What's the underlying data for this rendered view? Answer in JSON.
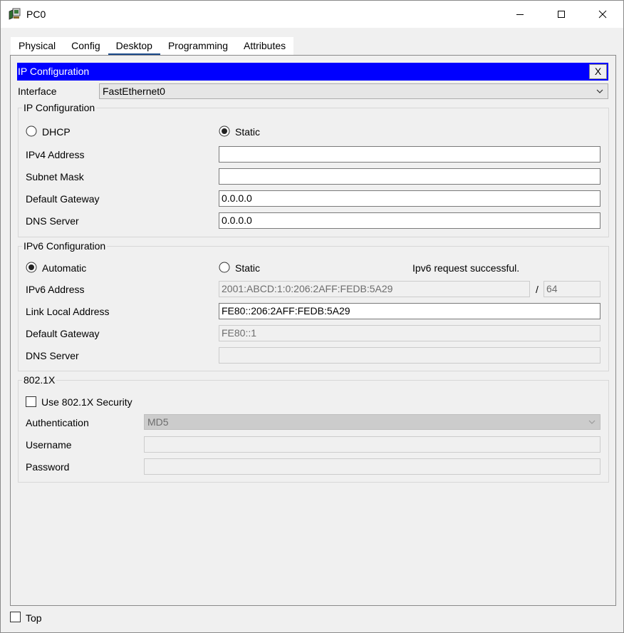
{
  "window": {
    "title": "PC0"
  },
  "tabs": [
    "Physical",
    "Config",
    "Desktop",
    "Programming",
    "Attributes"
  ],
  "active_tab": "Desktop",
  "ip_config_window": {
    "title": "IP Configuration",
    "close_label": "X"
  },
  "interface": {
    "label": "Interface",
    "value": "FastEthernet0"
  },
  "ipv4": {
    "group_title": "IP Configuration",
    "dhcp_label": "DHCP",
    "static_label": "Static",
    "mode": "Static",
    "ipv4_address_label": "IPv4 Address",
    "ipv4_address": "",
    "subnet_mask_label": "Subnet Mask",
    "subnet_mask": "",
    "default_gateway_label": "Default Gateway",
    "default_gateway": "0.0.0.0",
    "dns_server_label": "DNS Server",
    "dns_server": "0.0.0.0"
  },
  "ipv6": {
    "group_title": "IPv6 Configuration",
    "automatic_label": "Automatic",
    "static_label": "Static",
    "mode": "Automatic",
    "status": "Ipv6 request successful.",
    "ipv6_address_label": "IPv6 Address",
    "ipv6_address": "2001:ABCD:1:0:206:2AFF:FEDB:5A29",
    "prefix_separator": "/",
    "prefix_length": "64",
    "link_local_label": "Link Local Address",
    "link_local": "FE80::206:2AFF:FEDB:5A29",
    "default_gateway_label": "Default Gateway",
    "default_gateway": "FE80::1",
    "dns_server_label": "DNS Server",
    "dns_server": ""
  },
  "dot1x": {
    "group_title": "802.1X",
    "use_security_label": "Use 802.1X Security",
    "use_security_checked": false,
    "authentication_label": "Authentication",
    "authentication": "MD5",
    "username_label": "Username",
    "username": "",
    "password_label": "Password",
    "password": ""
  },
  "footer": {
    "top_label": "Top",
    "top_checked": false
  },
  "colors": {
    "header_blue": "#0000ff",
    "active_tab_underline": "#1a4a8a"
  }
}
